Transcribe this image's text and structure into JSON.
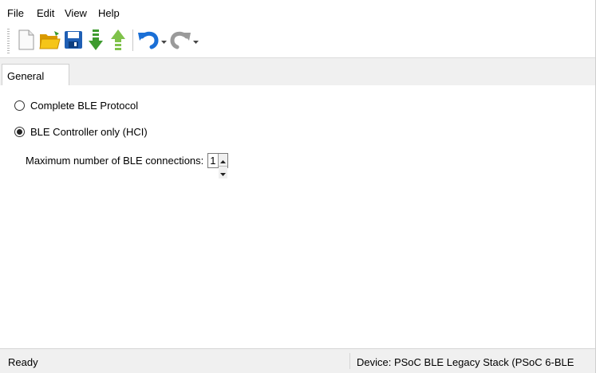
{
  "menu": {
    "file": "File",
    "edit": "Edit",
    "view": "View",
    "help": "Help"
  },
  "toolbar": {
    "icons": [
      "new-document-icon",
      "open-folder-icon",
      "save-icon",
      "import-icon",
      "export-icon",
      "undo-icon",
      "redo-icon"
    ],
    "colors": {
      "open": "#f0b400",
      "save": "#1f5fb4",
      "import": "#3e9b2f",
      "export": "#7fc24a",
      "undo": "#1a6fd6",
      "redo": "#9a9a9a"
    }
  },
  "tabs": [
    {
      "label": "General",
      "selected": true
    }
  ],
  "general": {
    "option_complete": "Complete BLE Protocol",
    "option_controller": "BLE Controller only (HCI)",
    "selected_option": "BLE Controller only (HCI)",
    "max_connections_label": "Maximum number of BLE connections:",
    "max_connections_value": "1"
  },
  "status": {
    "left": "Ready",
    "right": "Device: PSoC BLE Legacy Stack (PSoC 6-BLE"
  }
}
